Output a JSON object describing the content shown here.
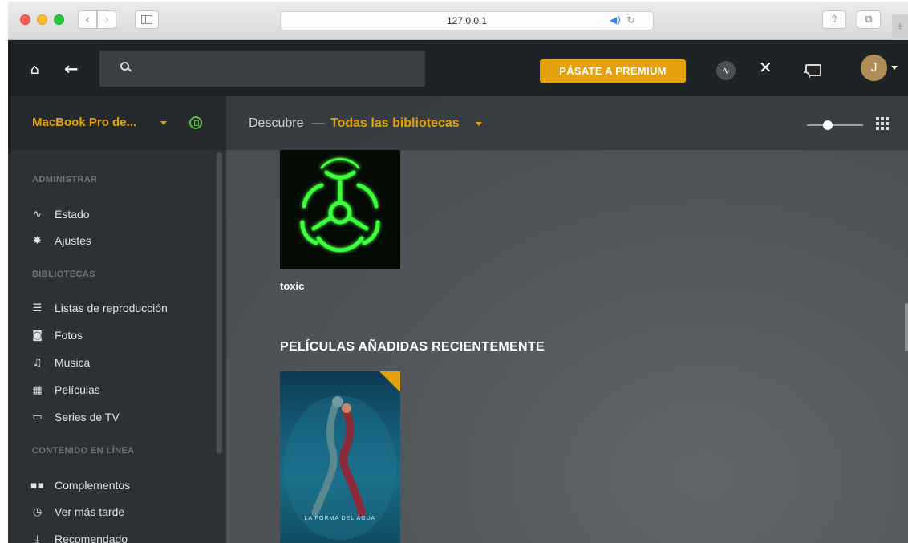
{
  "browser": {
    "url": "127.0.0.1",
    "nav_back_glyph": "‹",
    "nav_forward_glyph": "›",
    "share_glyph": "⇧",
    "tabs_glyph": "⧉",
    "new_tab_glyph": "+",
    "audio_glyph": "◀)",
    "reload_glyph": "↻"
  },
  "topbar": {
    "home_glyph": "⌂",
    "back_glyph": "←",
    "search_placeholder": "",
    "premium_label": "PÁSATE A PREMIUM",
    "activity_glyph": "∿",
    "tools_glyph": "✕",
    "avatar_initial": "J"
  },
  "sidebar": {
    "server_name": "MacBook Pro de...",
    "sections": [
      {
        "title": "ADMINISTRAR",
        "items": [
          {
            "label": "Estado",
            "icon": "pulse-icon",
            "glyph": "∿"
          },
          {
            "label": "Ajustes",
            "icon": "gear-icon",
            "glyph": "✸"
          }
        ]
      },
      {
        "title": "BIBLIOTECAS",
        "items": [
          {
            "label": "Listas de reproducción",
            "icon": "list-icon",
            "glyph": "☰"
          },
          {
            "label": "Fotos",
            "icon": "camera-icon",
            "glyph": "◙"
          },
          {
            "label": "Musica",
            "icon": "music-note-icon",
            "glyph": "♫"
          },
          {
            "label": "Películas",
            "icon": "film-icon",
            "glyph": "▦"
          },
          {
            "label": "Series de TV",
            "icon": "tv-icon",
            "glyph": "▭"
          }
        ]
      },
      {
        "title": "CONTENIDO EN LÍNEA",
        "items": [
          {
            "label": "Complementos",
            "icon": "grid-icon",
            "glyph": "▪▪"
          },
          {
            "label": "Ver más tarde",
            "icon": "clock-icon",
            "glyph": "◷"
          },
          {
            "label": "Recomendado",
            "icon": "download-icon",
            "glyph": "⤓"
          }
        ]
      }
    ]
  },
  "main": {
    "crumb_discover": "Descubre",
    "crumb_dash": "—",
    "crumb_libraries": "Todas las bibliotecas",
    "item_toxic": "toxic",
    "section_recent_movies": "PELÍCULAS AÑADIDAS RECIENTEMENTE",
    "movie_poster_text": "LA FORMA DEL AGUA"
  },
  "colors": {
    "accent": "#e5a00d",
    "topbar": "#1f2326",
    "sidebar": "#2c3135",
    "server_online": "#5bbd45"
  }
}
